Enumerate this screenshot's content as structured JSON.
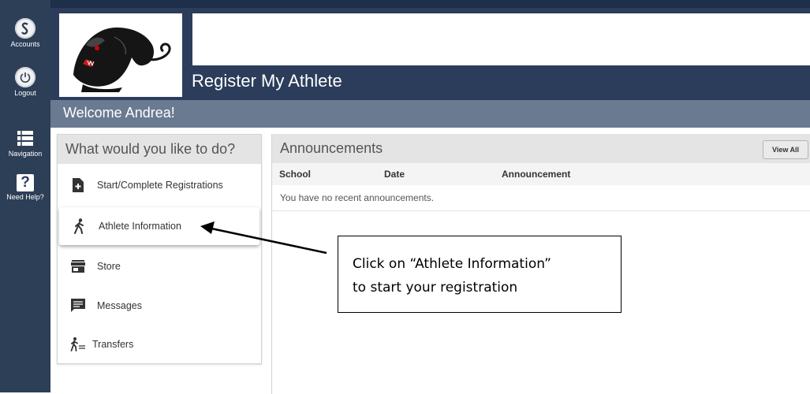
{
  "sidebar": {
    "accounts_label": "Accounts",
    "logout_label": "Logout",
    "navigation_label": "Navigation",
    "help_label": "Need Help?",
    "help_glyph": "?"
  },
  "header": {
    "app_title": "Register My Athlete",
    "welcome": "Welcome Andrea!"
  },
  "menu": {
    "heading": "What would you like to do?",
    "items": [
      {
        "label": "Start/Complete Registrations",
        "icon": "add-document-icon"
      },
      {
        "label": "Athlete Information",
        "icon": "walking-person-icon"
      },
      {
        "label": "Store",
        "icon": "store-icon"
      },
      {
        "label": "Messages",
        "icon": "message-icon"
      },
      {
        "label": "Transfers",
        "icon": "transfer-person-icon"
      }
    ]
  },
  "announcements": {
    "title": "Announcements",
    "view_all": "View All",
    "columns": [
      "School",
      "Date",
      "Announcement"
    ],
    "empty_text": "You have no recent announcements."
  },
  "callout": {
    "line1": "Click on “Athlete Information”",
    "line2": "to start your registration"
  },
  "colors": {
    "sidebar": "#2d3e57",
    "header": "#2b3d5b",
    "welcome_bar": "#6a7a90"
  }
}
